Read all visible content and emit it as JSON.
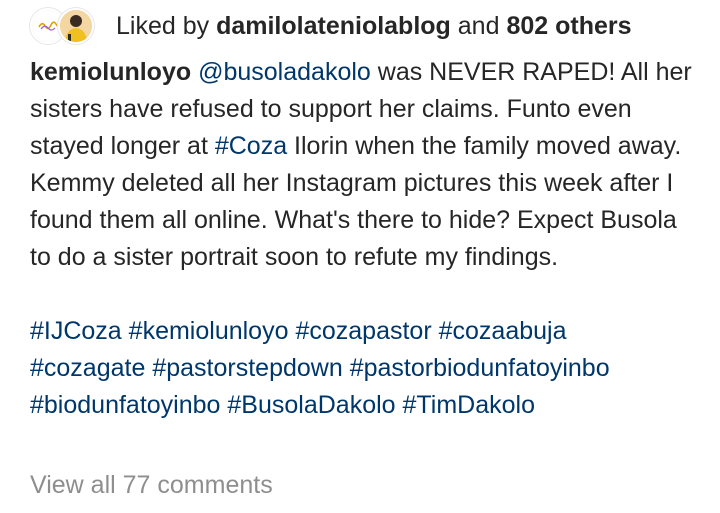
{
  "likes": {
    "prefix": "Liked by",
    "user": "damilolateniolablog",
    "conjunction": "and",
    "others": "802 others"
  },
  "post": {
    "author": "kemiolunloyo",
    "caption_segments": [
      {
        "type": "mention",
        "text": "@busoladakolo"
      },
      {
        "type": "text",
        "text": " was NEVER RAPED! All her sisters have refused to support her claims. Funto even stayed longer at "
      },
      {
        "type": "hashtag",
        "text": "#Coza"
      },
      {
        "type": "text",
        "text": " Ilorin when the family moved away. Kemmy deleted all her Instagram pictures this week after I found them all online. What's there to hide? Expect Busola to do a sister portrait soon to refute my findings."
      }
    ],
    "hashtag_lines": [
      [
        "#IJCoza",
        "#kemiolunloyo",
        "#cozapastor",
        "#cozaabuja"
      ],
      [
        "#cozagate",
        "#pastorstepdown",
        "#pastorbiodunfatoyinbo"
      ],
      [
        "#biodunfatoyinbo",
        "#BusolaDakolo",
        "#TimDakolo"
      ]
    ]
  },
  "comments": {
    "view_all_label": "View all 77 comments"
  },
  "colors": {
    "text": "#262626",
    "link": "#00376b",
    "muted": "#8e8e8e"
  }
}
